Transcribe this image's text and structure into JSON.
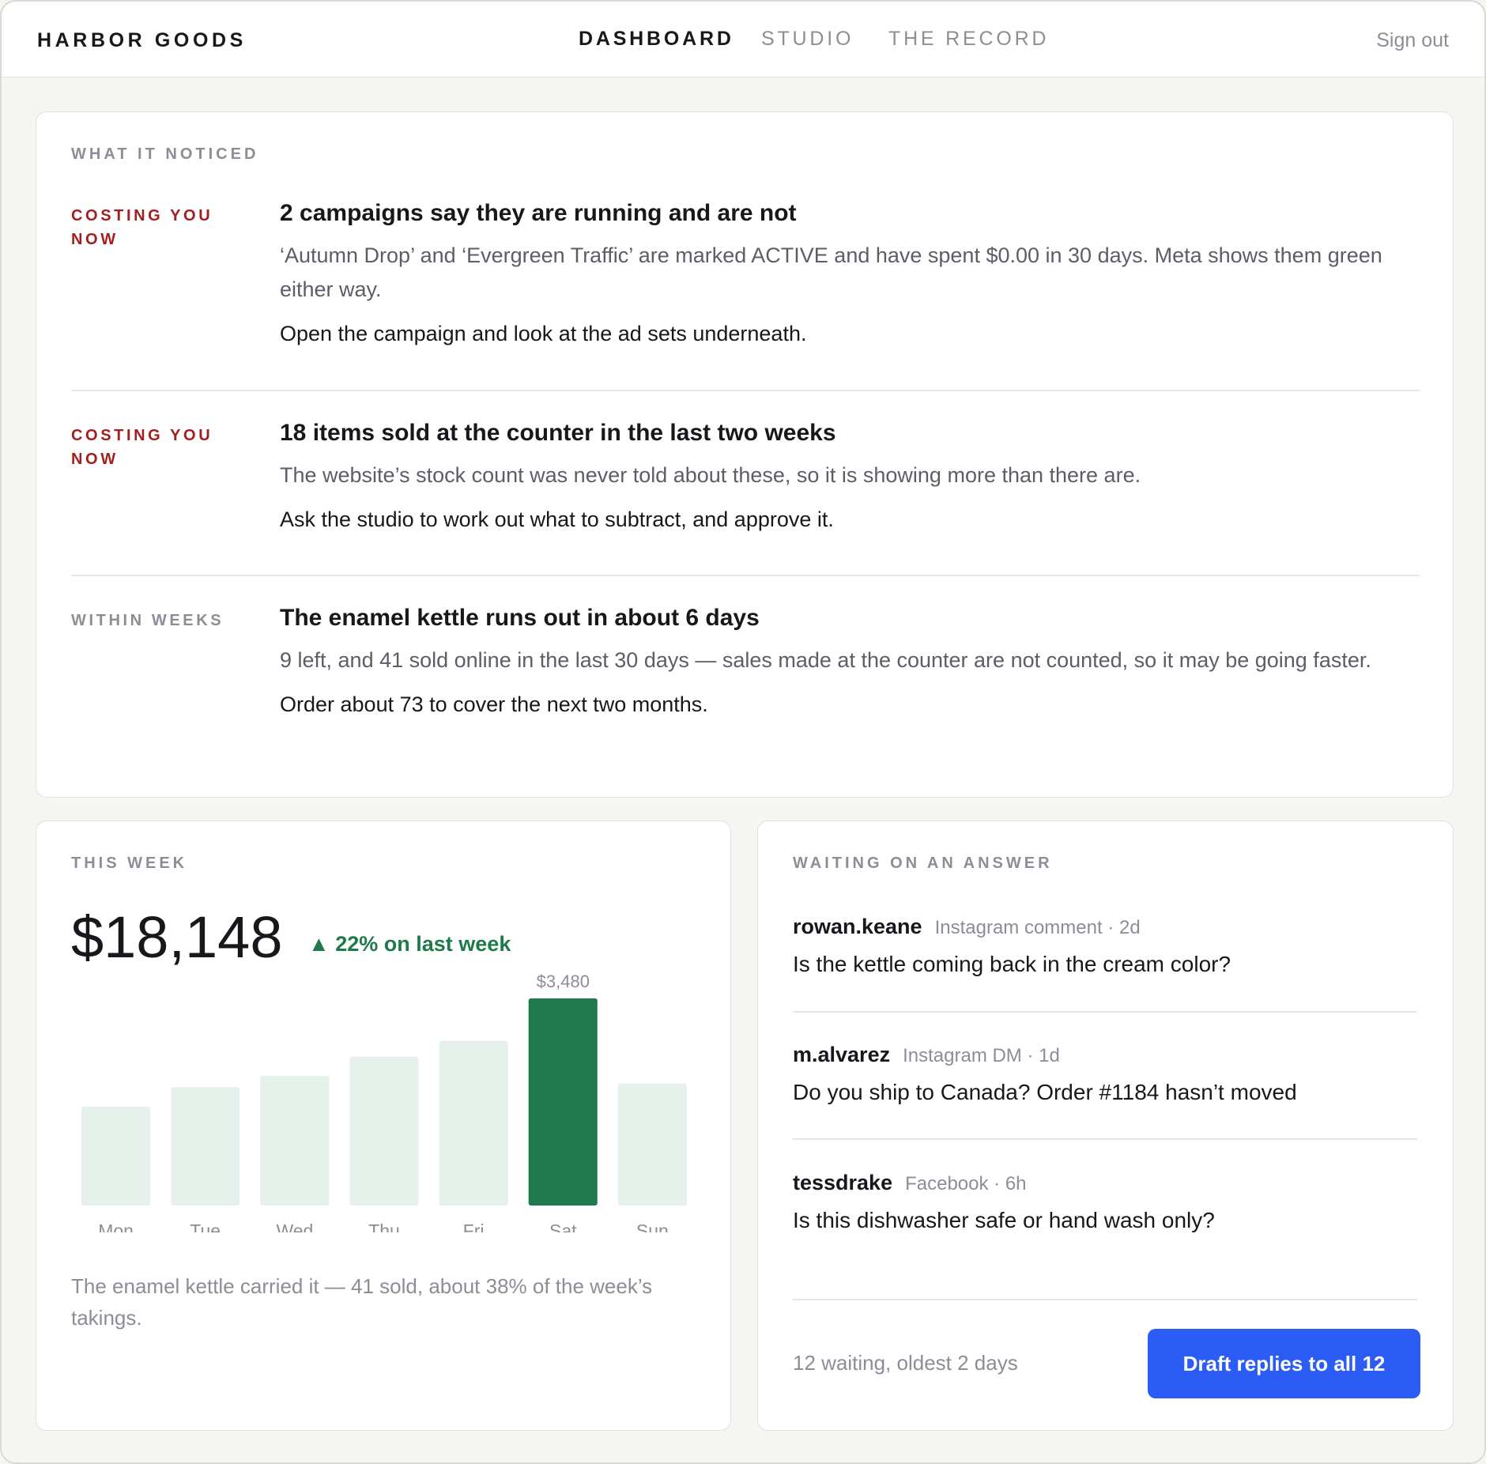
{
  "header": {
    "brand": "HARBOR GOODS",
    "nav": [
      {
        "label": "DASHBOARD",
        "active": true
      },
      {
        "label": "STUDIO",
        "active": false
      },
      {
        "label": "THE RECORD",
        "active": false
      }
    ],
    "sign_out": "Sign out"
  },
  "noticed": {
    "heading": "WHAT IT NOTICED",
    "items": [
      {
        "tag": "COSTING YOU NOW",
        "severity": "urgent",
        "title": "2 campaigns say they are running and are not",
        "description": "‘Autumn Drop’ and ‘Evergreen Traffic’ are marked ACTIVE and have spent $0.00 in 30 days. Meta shows them green either way.",
        "action": "Open the campaign and look at the ad sets underneath."
      },
      {
        "tag": "COSTING YOU NOW",
        "severity": "urgent",
        "title": "18 items sold at the counter in the last two weeks",
        "description": "The website’s stock count was never told about these, so it is showing more than there are.",
        "action": "Ask the studio to work out what to subtract, and approve it."
      },
      {
        "tag": "WITHIN WEEKS",
        "severity": "soon",
        "title": "The enamel kettle runs out in about 6 days",
        "description": "9 left, and 41 sold online in the last 30 days — sales made at the counter are not counted, so it may be going faster.",
        "action": "Order about 73 to cover the next two months."
      }
    ]
  },
  "week": {
    "heading": "THIS WEEK",
    "total": "$18,148",
    "delta": "▲ 22% on last week",
    "caption": "The enamel kettle carried it — 41 sold, about 38% of the week’s takings."
  },
  "chart_data": {
    "type": "bar",
    "categories": [
      "Mon",
      "Tue",
      "Wed",
      "Thu",
      "Fri",
      "Sat",
      "Sun"
    ],
    "values": [
      1660,
      1990,
      2180,
      2500,
      2770,
      3480,
      2050
    ],
    "highlight_index": 5,
    "data_labels": {
      "Sat": "$3,480"
    },
    "ylim": [
      0,
      3480
    ],
    "colors": {
      "bar": "#e6f1eb",
      "highlight": "#1e7a4a",
      "label": "#8b8e96"
    }
  },
  "waiting": {
    "heading": "WAITING ON AN ANSWER",
    "messages": [
      {
        "user": "rowan.keane",
        "meta": "Instagram comment · 2d",
        "text": "Is the kettle coming back in the cream color?"
      },
      {
        "user": "m.alvarez",
        "meta": "Instagram DM · 1d",
        "text": "Do you ship to Canada? Order #1184 hasn’t moved"
      },
      {
        "user": "tessdrake",
        "meta": "Facebook · 6h",
        "text": "Is this dishwasher safe or hand wash only?"
      }
    ],
    "status": "12 waiting, oldest 2 days",
    "button": "Draft replies to all 12"
  },
  "colors": {
    "urgent": "#a31f1f",
    "positive": "#1e7a4a",
    "primary_button": "#2b5cf5"
  }
}
